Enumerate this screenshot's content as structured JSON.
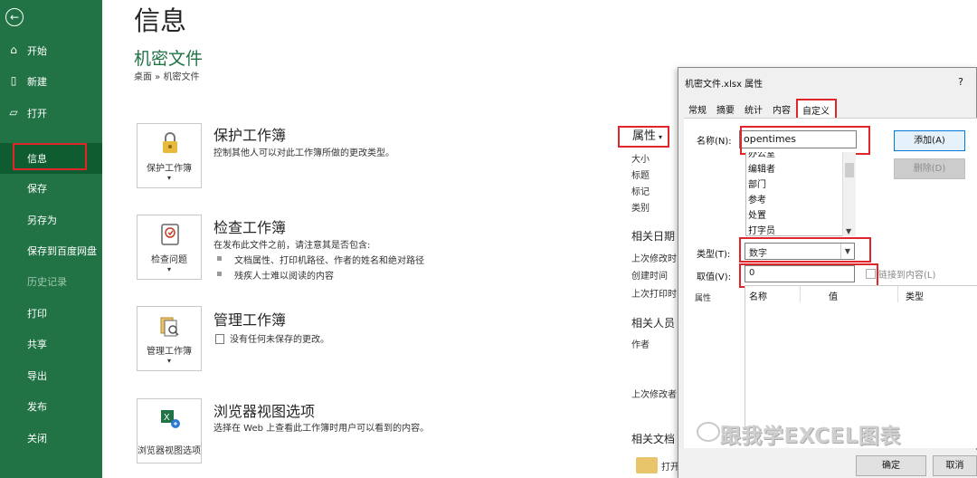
{
  "sidebar": {
    "back_icon": "back-arrow-icon",
    "items": [
      {
        "label": "开始",
        "icon": "home-icon"
      },
      {
        "label": "新建",
        "icon": "new-document-icon"
      },
      {
        "label": "打开",
        "icon": "folder-open-icon"
      },
      {
        "label": "信息"
      },
      {
        "label": "保存"
      },
      {
        "label": "另存为"
      },
      {
        "label": "保存到百度网盘"
      },
      {
        "label": "历史记录"
      },
      {
        "label": "打印"
      },
      {
        "label": "共享"
      },
      {
        "label": "导出"
      },
      {
        "label": "发布"
      },
      {
        "label": "关闭"
      }
    ]
  },
  "main": {
    "title": "信息",
    "file_name": "机密文件",
    "breadcrumb": "桌面 » 机密文件",
    "sections": [
      {
        "card_label": "保护工作簿",
        "title": "保护工作簿",
        "desc": "控制其他人可以对此工作簿所做的更改类型。"
      },
      {
        "card_label": "检查问题",
        "title": "检查工作簿",
        "desc": "在发布此文件之前，请注意其是否包含:",
        "bullets": [
          "文档属性、打印机路径、作者的姓名和绝对路径",
          "残疾人士难以阅读的内容"
        ]
      },
      {
        "card_label": "管理工作簿",
        "title": "管理工作簿",
        "desc": "没有任何未保存的更改。"
      },
      {
        "card_label": "浏览器视图选项",
        "title": "浏览器视图选项",
        "desc": "选择在 Web 上查看此工作簿时用户可以看到的内容。"
      }
    ]
  },
  "properties": {
    "button_label": "属性",
    "fields": [
      "大小",
      "标题",
      "标记",
      "类别"
    ],
    "related_dates_head": "相关日期",
    "date_fields": [
      "上次修改时",
      "创建时间",
      "上次打印时"
    ],
    "related_people_head": "相关人员",
    "author_label": "作者",
    "last_modified_by": "上次修改者",
    "related_docs_head": "相关文档",
    "open_label": "打开"
  },
  "dialog": {
    "title": "机密文件.xlsx 属性",
    "help": "?",
    "tabs": [
      "常规",
      "摘要",
      "统计",
      "内容",
      "自定义"
    ],
    "name_label": "名称(N):",
    "name_value": "opentimes",
    "name_list": [
      "办公室",
      "编辑者",
      "部门",
      "参考",
      "处置",
      "打字员"
    ],
    "add_button": "添加(A)",
    "delete_button": "删除(D)",
    "type_label": "类型(T):",
    "type_value": "数字",
    "value_label": "取值(V):",
    "value_value": "0",
    "link_label": "链接到内容(L)",
    "props_label": "属性",
    "table_headers": [
      "名称",
      "值",
      "类型"
    ],
    "ok_button": "确定",
    "cancel_button": "取消"
  },
  "watermark": "跟我学EXCEL图表",
  "colors": {
    "sidebar_bg": "#217346",
    "highlight": "#e0262b",
    "title_green": "#217346"
  }
}
